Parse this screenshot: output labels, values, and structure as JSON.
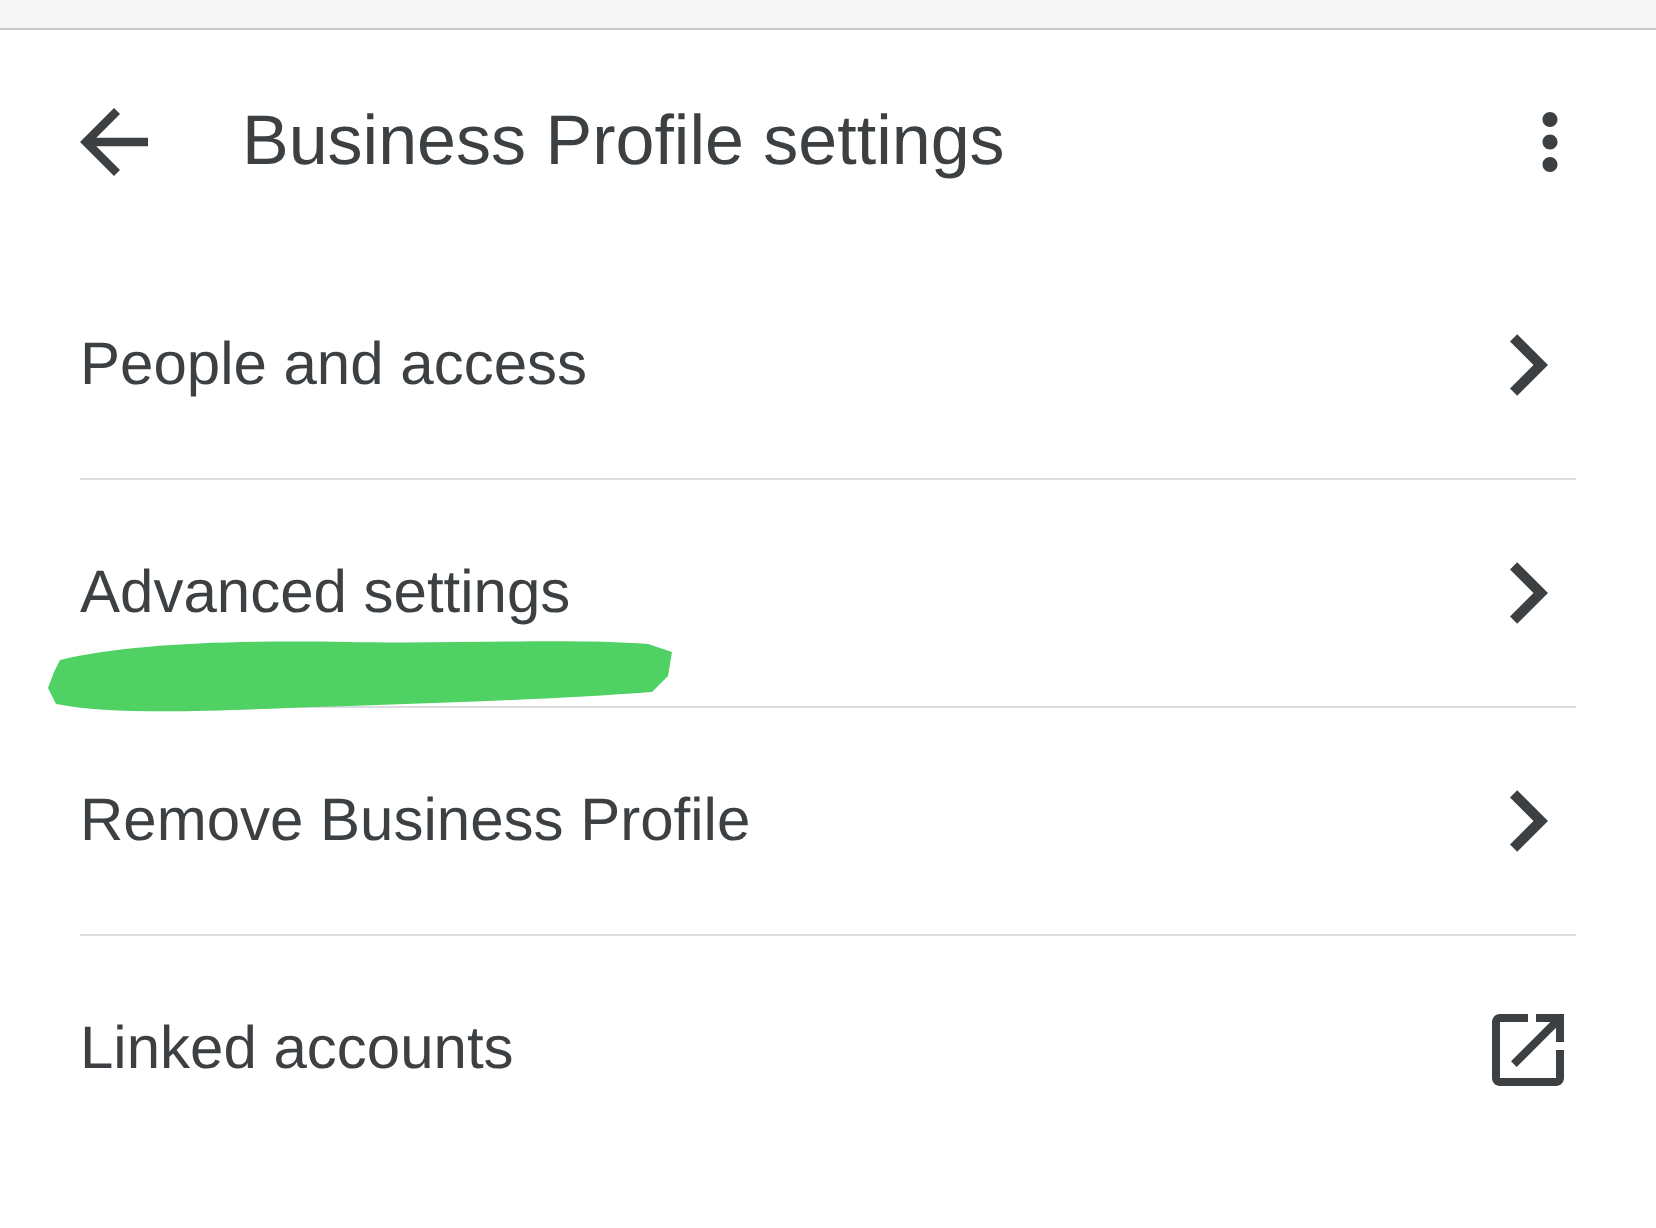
{
  "header": {
    "title": "Business Profile settings"
  },
  "items": [
    {
      "label": "People and access",
      "kind": "chevron",
      "highlighted": false
    },
    {
      "label": "Advanced settings",
      "kind": "chevron",
      "highlighted": true
    },
    {
      "label": "Remove Business Profile",
      "kind": "chevron",
      "highlighted": false
    },
    {
      "label": "Linked accounts",
      "kind": "external",
      "highlighted": false
    }
  ]
}
